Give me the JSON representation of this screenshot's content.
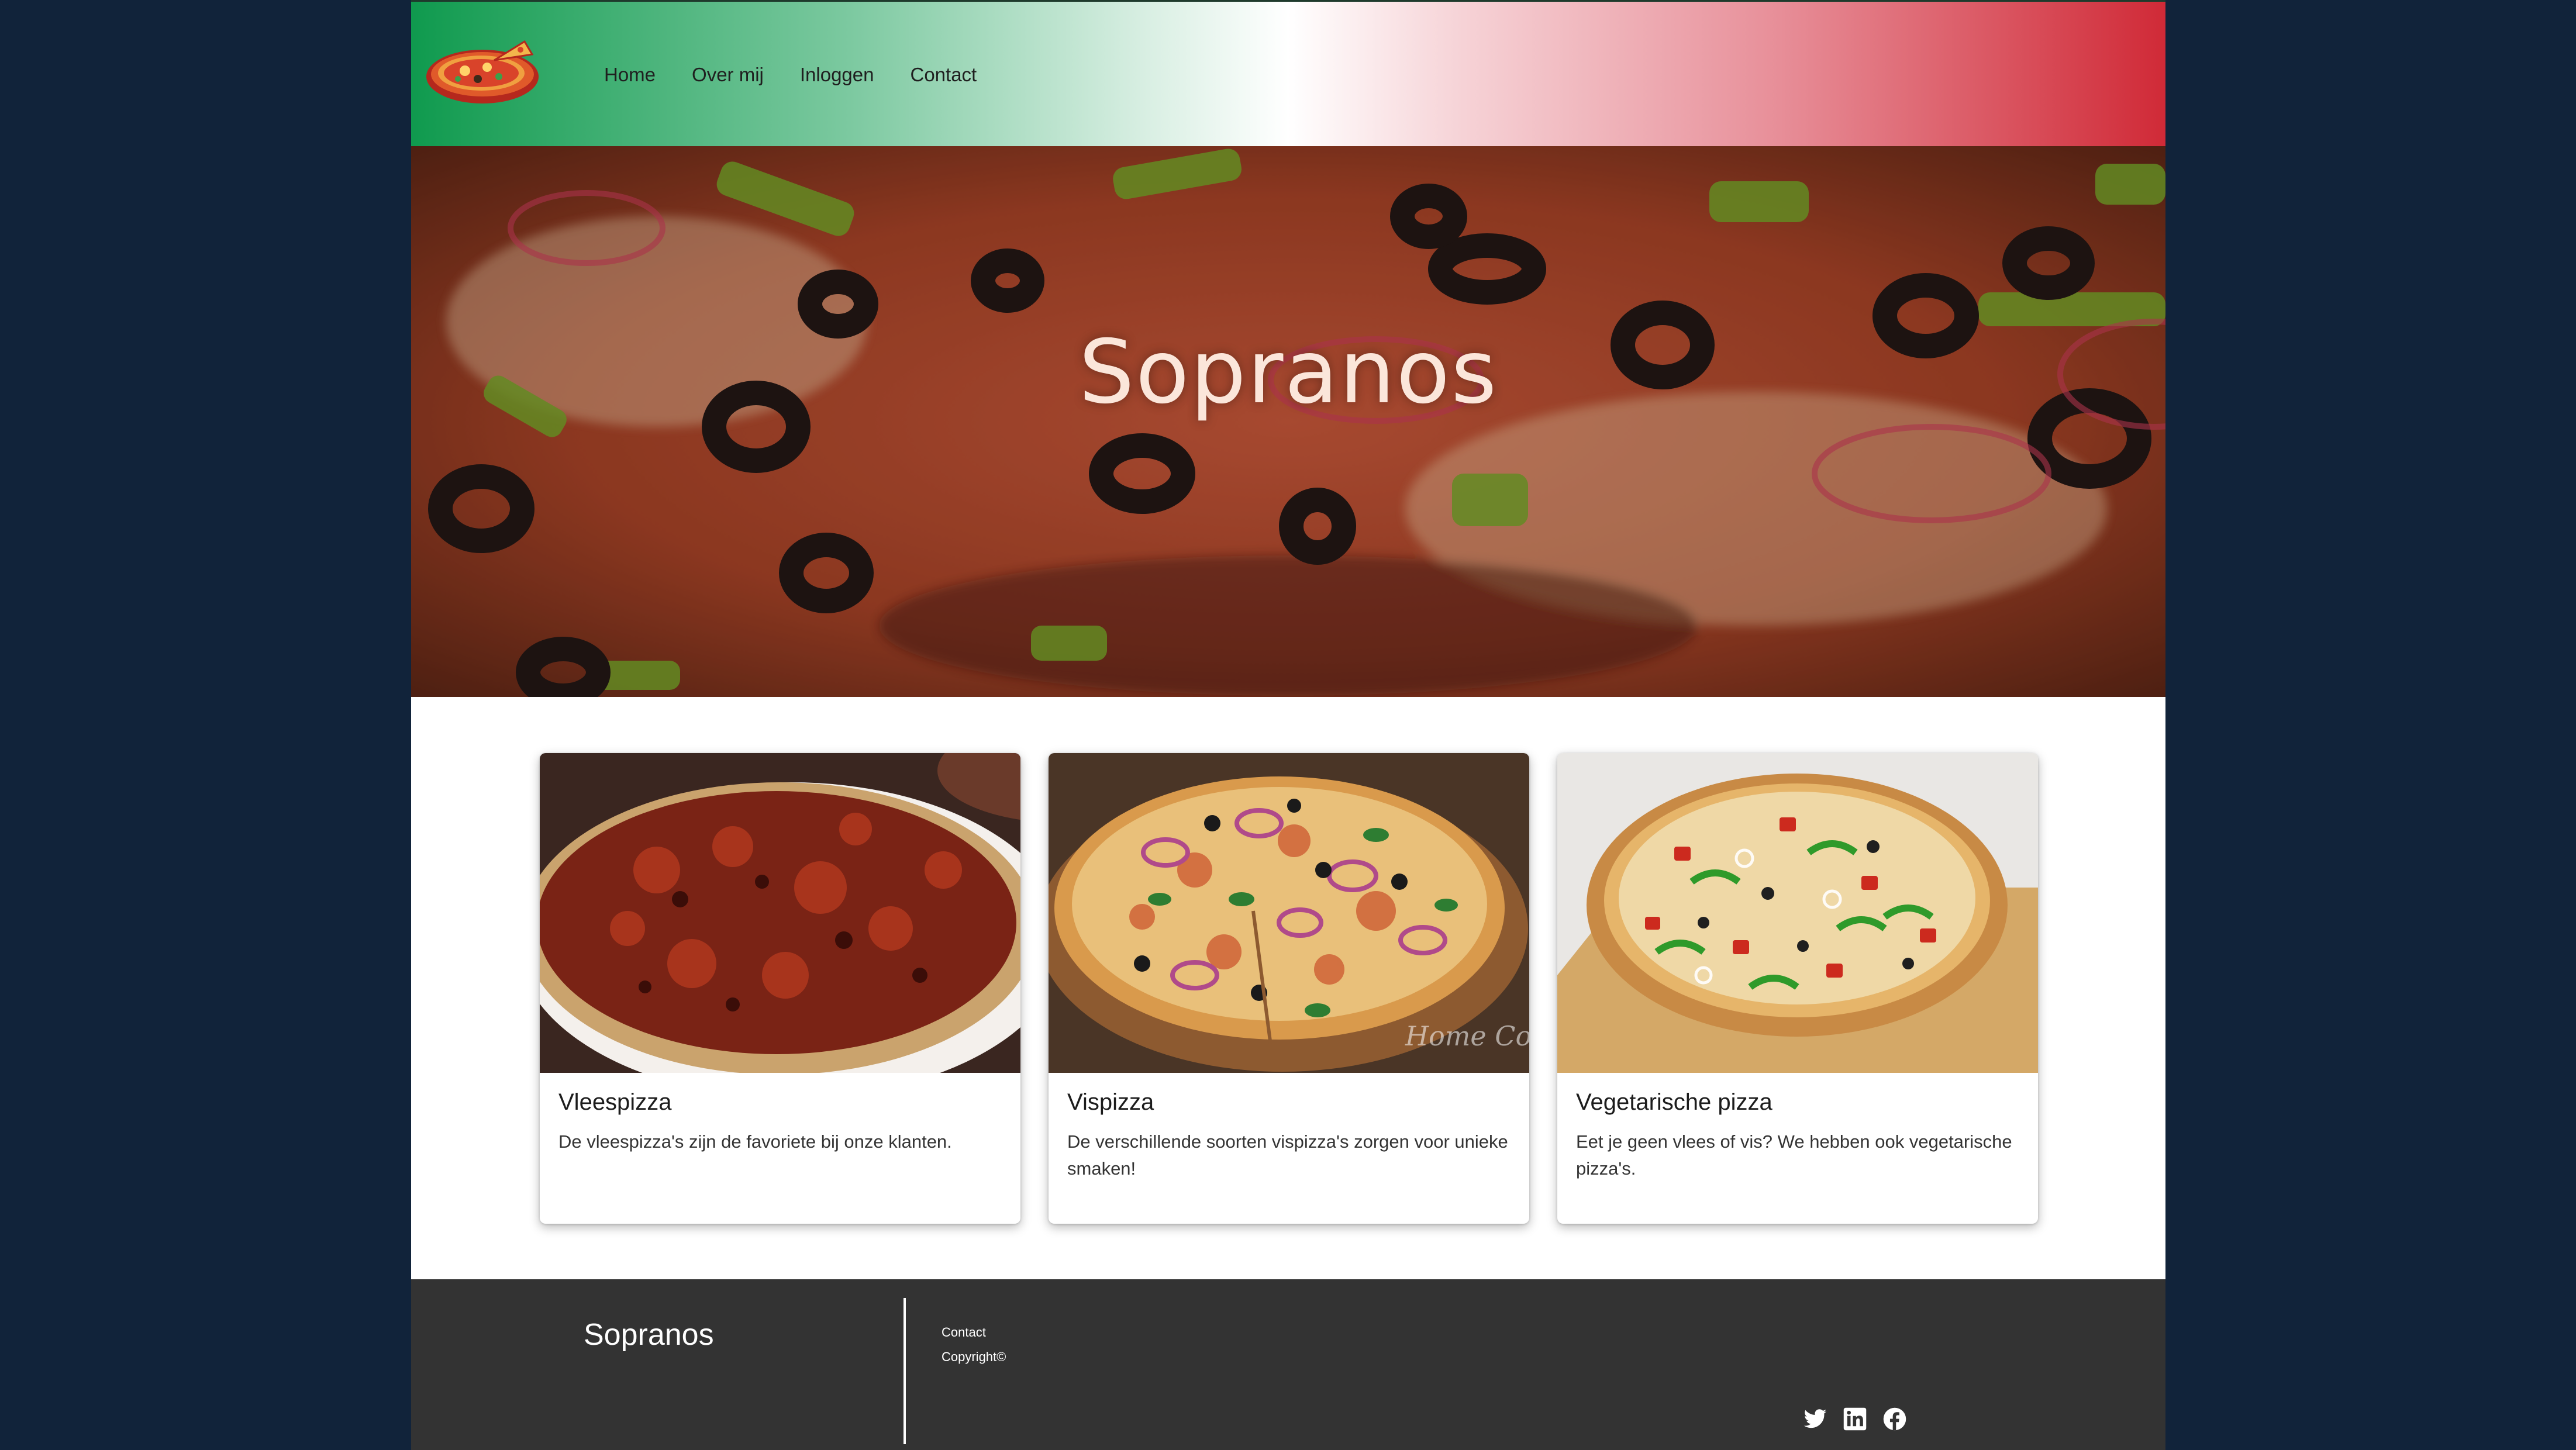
{
  "nav": {
    "links": [
      "Home",
      "Over mij",
      "Inloggen",
      "Contact"
    ]
  },
  "hero": {
    "title": "Sopranos"
  },
  "cards": [
    {
      "title": "Vleespizza",
      "text": "De vleespizza's zijn de favoriete bij onze klanten."
    },
    {
      "title": "Vispizza",
      "text": "De verschillende soorten vispizza's zorgen voor unieke smaken!",
      "image_watermark": "Home Cooking"
    },
    {
      "title": "Vegetarische pizza",
      "text": "Eet je geen vlees of vis? We hebben ook vegetarische pizza's."
    }
  ],
  "footer": {
    "brand": "Sopranos",
    "links": [
      "Contact",
      "Copyright©"
    ],
    "social_icons": [
      "twitter-icon",
      "linkedin-icon",
      "facebook-icon"
    ]
  },
  "colors": {
    "background": "#11233a",
    "flag_green": "#0f9a4e",
    "flag_red": "#d02a37",
    "footer": "#333333"
  }
}
